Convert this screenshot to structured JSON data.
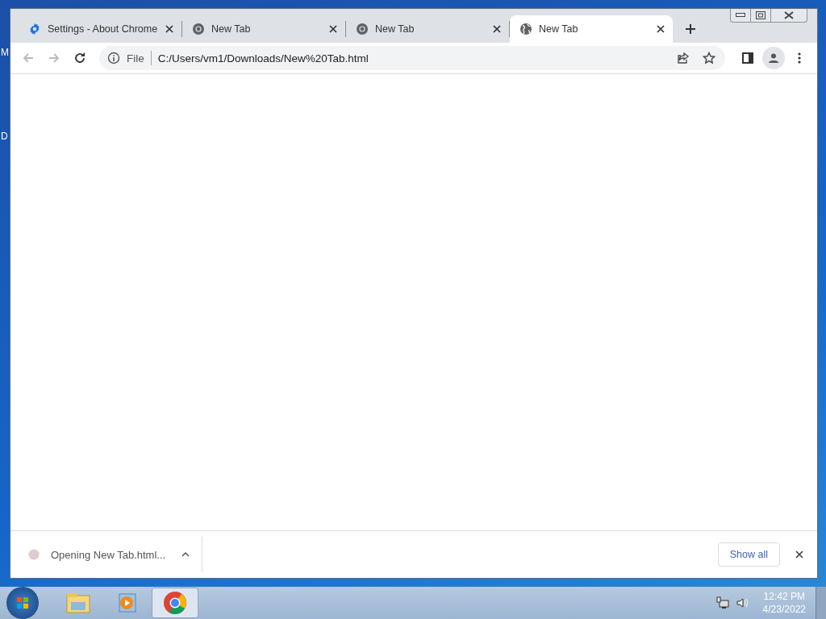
{
  "desktop_labels": [
    "M",
    "D"
  ],
  "window": {
    "tabs": [
      {
        "title": "Settings - About Chrome",
        "kind": "settings",
        "selected": false
      },
      {
        "title": "New Tab",
        "kind": "chrome",
        "selected": false
      },
      {
        "title": "New Tab",
        "kind": "chrome",
        "selected": false
      },
      {
        "title": "New Tab",
        "kind": "globe",
        "selected": true
      }
    ],
    "toolbar": {
      "back_disabled": true,
      "forward_disabled": true,
      "scheme": "File",
      "url": "C:/Users/vm1/Downloads/New%20Tab.html"
    },
    "download_bar": {
      "item": "Opening New Tab.html...",
      "show_all": "Show all"
    }
  },
  "taskbar": {
    "apps": [
      {
        "kind": "explorer",
        "selected": false
      },
      {
        "kind": "media",
        "selected": false
      },
      {
        "kind": "chrome",
        "selected": true
      }
    ],
    "time": "12:42 PM",
    "date": "4/23/2022"
  }
}
